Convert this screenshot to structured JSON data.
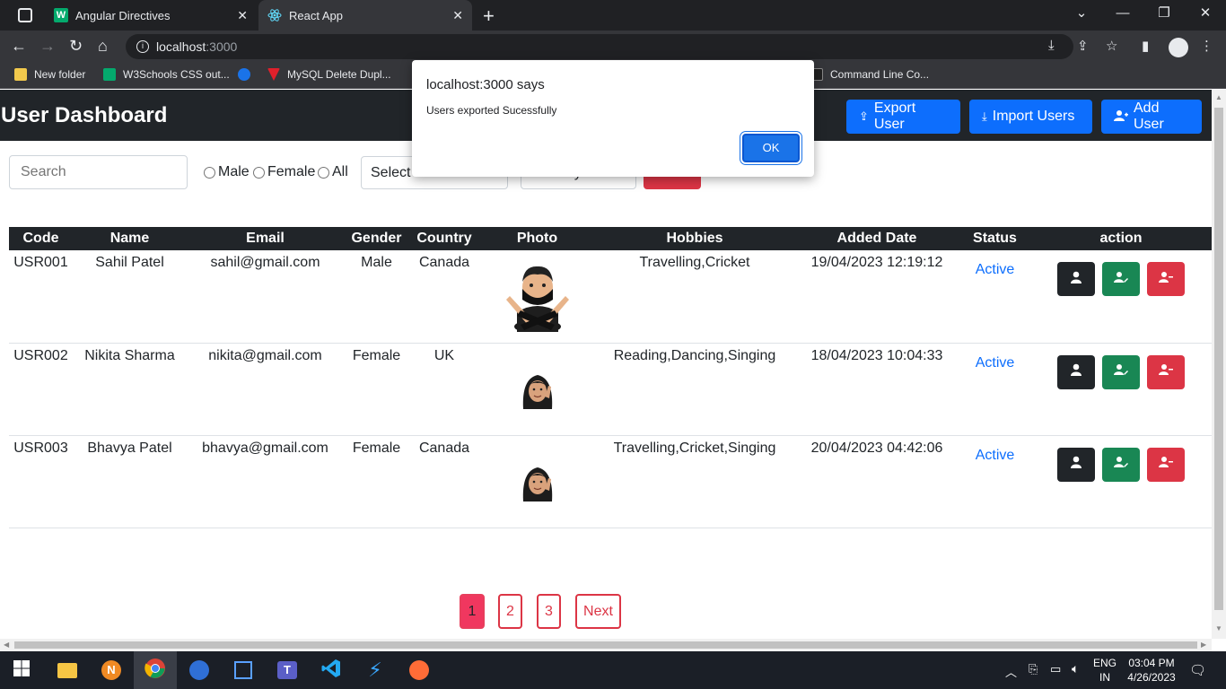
{
  "browser": {
    "tabs": [
      {
        "title": "Angular Directives",
        "icon": "w3schools-icon",
        "active": false
      },
      {
        "title": "React App",
        "icon": "react-icon",
        "active": true
      }
    ],
    "url_host": "localhost",
    "url_port": ":3000",
    "bookmarks": [
      {
        "label": "New folder",
        "icon": "folder-icon"
      },
      {
        "label": "W3Schools CSS out...",
        "icon": "w3schools-icon"
      },
      {
        "label": "",
        "icon": "chrome-ext-icon"
      },
      {
        "label": "MySQL Delete Dupl...",
        "icon": "mysql-icon"
      },
      {
        "label": "Command Line Co...",
        "icon": "site-icon"
      }
    ]
  },
  "app": {
    "title": "User Dashboard",
    "buttons": {
      "export": "Export User",
      "import": "Import Users",
      "add": "Add User"
    },
    "filters": {
      "search_placeholder": "Search",
      "gender_options": [
        "Male",
        "Female",
        "All"
      ],
      "hobbies_select": "Select hobbies",
      "status_select": "Filter by status",
      "reset": "Reset"
    },
    "table": {
      "headers": [
        "Code",
        "Name",
        "Email",
        "Gender",
        "Country",
        "Photo",
        "Hobbies",
        "Added Date",
        "Status",
        "action"
      ],
      "rows": [
        {
          "code": "USR001",
          "name": "Sahil Patel",
          "email": "sahil@gmail.com",
          "gender": "Male",
          "country": "Canada",
          "photo": "memoji-male-avatar",
          "hobbies": "Travelling,Cricket",
          "added": "19/04/2023 12:19:12",
          "status": "Active"
        },
        {
          "code": "USR002",
          "name": "Nikita Sharma",
          "email": "nikita@gmail.com",
          "gender": "Female",
          "country": "UK",
          "photo": "memoji-female-avatar",
          "hobbies": "Reading,Dancing,Singing",
          "added": "18/04/2023 10:04:33",
          "status": "Active"
        },
        {
          "code": "USR003",
          "name": "Bhavya Patel",
          "email": "bhavya@gmail.com",
          "gender": "Female",
          "country": "Canada",
          "photo": "memoji-female-avatar",
          "hobbies": "Travelling,Cricket,Singing",
          "added": "20/04/2023 04:42:06",
          "status": "Active"
        }
      ]
    },
    "pagination": {
      "pages": [
        "1",
        "2",
        "3"
      ],
      "current": "1",
      "next": "Next"
    }
  },
  "dialog": {
    "title": "localhost:3000 says",
    "message": "Users exported Sucessfully",
    "ok": "OK"
  },
  "taskbar": {
    "language": "ENG",
    "region": "IN",
    "time": "03:04 PM",
    "date": "4/26/2023"
  },
  "colors": {
    "primary": "#0d6efd",
    "success": "#198754",
    "danger": "#dc3545",
    "dark": "#212529"
  }
}
